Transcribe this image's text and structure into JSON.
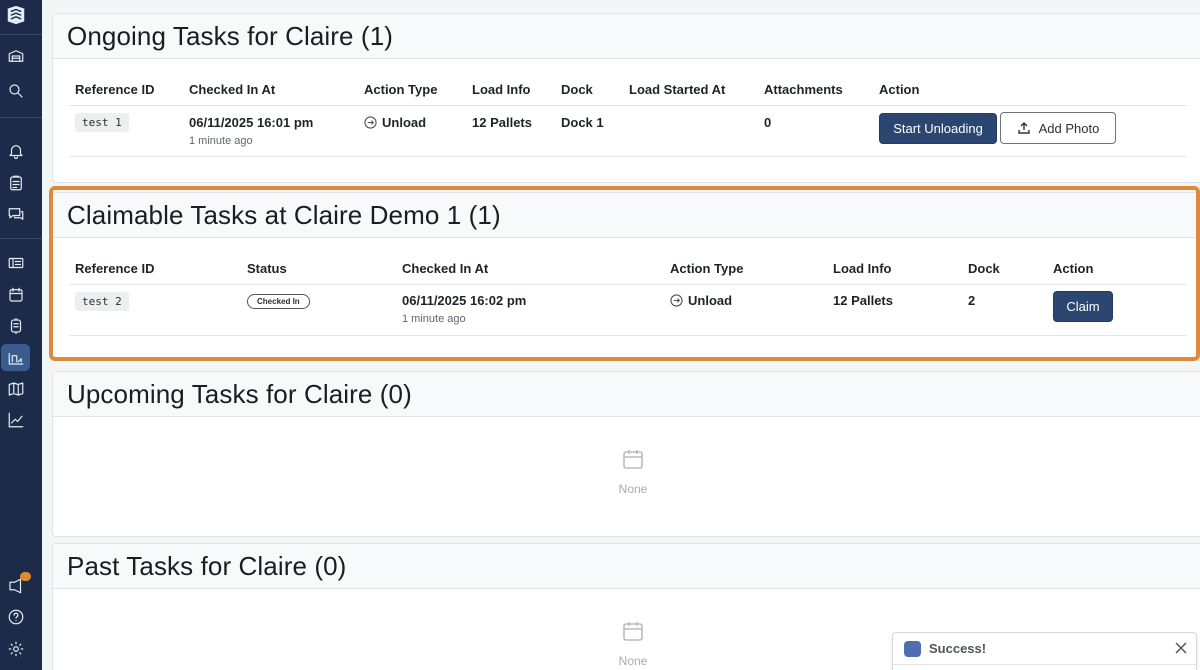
{
  "sidebar": {
    "icons": [
      "logo-icon",
      "warehouse-icon",
      "search-icon",
      "bell-icon",
      "clipboard-icon",
      "chat-icon",
      "ticket-icon",
      "calendar-icon",
      "box-icon",
      "dock-icon",
      "map-icon",
      "chart-icon",
      "announcement-icon",
      "help-icon",
      "gear-icon"
    ],
    "active_item": "dock-icon"
  },
  "ongoing": {
    "title": "Ongoing Tasks for Claire (1)",
    "headers": {
      "ref": "Reference ID",
      "checked_in": "Checked In At",
      "action_type": "Action Type",
      "load_info": "Load Info",
      "dock": "Dock",
      "load_started": "Load Started At",
      "attachments": "Attachments",
      "action": "Action"
    },
    "row": {
      "ref": "test 1",
      "checked_in": "06/11/2025 16:01 pm",
      "checked_in_ago": "1 minute ago",
      "action_type": "Unload",
      "load_info": "12 Pallets",
      "dock": "Dock 1",
      "load_started": "",
      "attachments": "0",
      "primary_button": "Start Unloading",
      "secondary_button": "Add Photo"
    }
  },
  "claimable": {
    "title": "Claimable Tasks at Claire Demo 1 (1)",
    "headers": {
      "ref": "Reference ID",
      "status": "Status",
      "checked_in": "Checked In At",
      "action_type": "Action Type",
      "load_info": "Load Info",
      "dock": "Dock",
      "action": "Action"
    },
    "row": {
      "ref": "test 2",
      "status": "Checked In",
      "checked_in": "06/11/2025 16:02 pm",
      "checked_in_ago": "1 minute ago",
      "action_type": "Unload",
      "load_info": "12 Pallets",
      "dock": "2",
      "button": "Claim"
    }
  },
  "upcoming": {
    "title": "Upcoming Tasks for Claire (0)",
    "empty_label": "None"
  },
  "past": {
    "title": "Past Tasks for Claire (0)",
    "empty_label": "None"
  },
  "toast": {
    "title": "Success!"
  },
  "colors": {
    "sidebar": "#1c2b4a",
    "primary_button": "#2b4670",
    "highlight": "#dd8a3c",
    "toast_swatch": "#4d6fb0"
  }
}
